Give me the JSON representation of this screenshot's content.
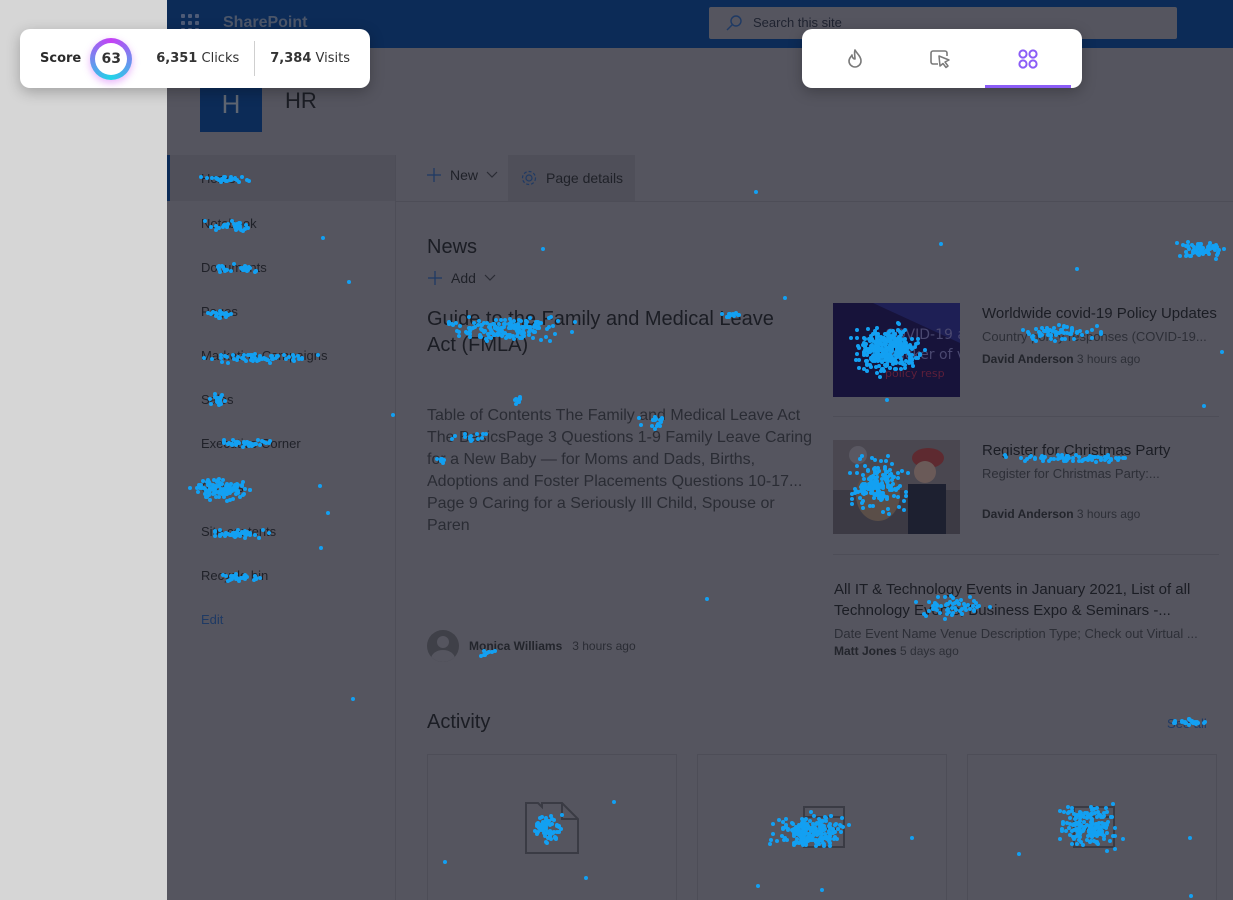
{
  "suitebar": {
    "app_name": "SharePoint",
    "search_placeholder": "Search this site"
  },
  "site": {
    "logo_letter": "H",
    "title": "HR"
  },
  "nav": {
    "items": [
      {
        "label": "Home",
        "selected": true
      },
      {
        "label": "Notebook"
      },
      {
        "label": "Documents"
      },
      {
        "label": "Pages"
      },
      {
        "label": "Marketing Campaigns"
      },
      {
        "label": "Sales"
      },
      {
        "label": "Executive Corner"
      },
      {
        "label": "Groups"
      },
      {
        "label": "Site contents"
      },
      {
        "label": "Recycle bin"
      }
    ],
    "edit_label": "Edit"
  },
  "command_bar": {
    "new_label": "New",
    "page_details_label": "Page details"
  },
  "news": {
    "title": "News",
    "add_label": "Add",
    "hero": {
      "title": "Guide to the Family and Medical Leave Act (FMLA)",
      "description": "Table of Contents The Family and Medical Leave Act The BasicsPage 3 Questions 1-9 Family Leave Caring for a New Baby — for Moms and Dads, Births, Adoptions and Foster Placements Questions 10-17... Page 9 Caring for a Seriously Ill Child, Spouse or Paren",
      "author": "Monica Williams",
      "time": "3 hours ago"
    },
    "side_items": [
      {
        "title": "Worldwide covid-19 Policy Updates",
        "description": "Country policy responses (COVID-19...",
        "author": "David Anderson",
        "time": "3 hours ago",
        "thumbnail": "covid-policy-image"
      },
      {
        "title": "Register for Christmas Party",
        "description": "Register for Christmas Party:...",
        "author": "David Anderson",
        "time": "3 hours ago",
        "thumbnail": "christmas-party-photo"
      },
      {
        "title": "All IT & Technology Events in January 2021, List of all Technology Events, Business Expo & Seminars -...",
        "description": "Date Event Name Venue Description Type; Check out Virtual ...",
        "author": "Matt Jones",
        "time": "5 days ago"
      }
    ]
  },
  "activity": {
    "title": "Activity",
    "see_all_label": "See all",
    "cards": [
      {
        "icon": "file-icon"
      },
      {
        "icon": "page-icon"
      },
      {
        "icon": "page-icon"
      }
    ]
  },
  "heatmap_overlay": {
    "score_label": "Score",
    "score": "63",
    "clicks_value": "6,351",
    "clicks_label": "Clicks",
    "visits_value": "7,384",
    "visits_label": "Visits",
    "modes": [
      {
        "name": "heatmap",
        "icon": "flame-icon",
        "active": false
      },
      {
        "name": "clicks",
        "icon": "cursor-click-icon",
        "active": false
      },
      {
        "name": "elements",
        "icon": "four-circles-icon",
        "active": true
      }
    ],
    "dot_color": "#13a0f2",
    "accent_color": "#8b5cf6"
  }
}
